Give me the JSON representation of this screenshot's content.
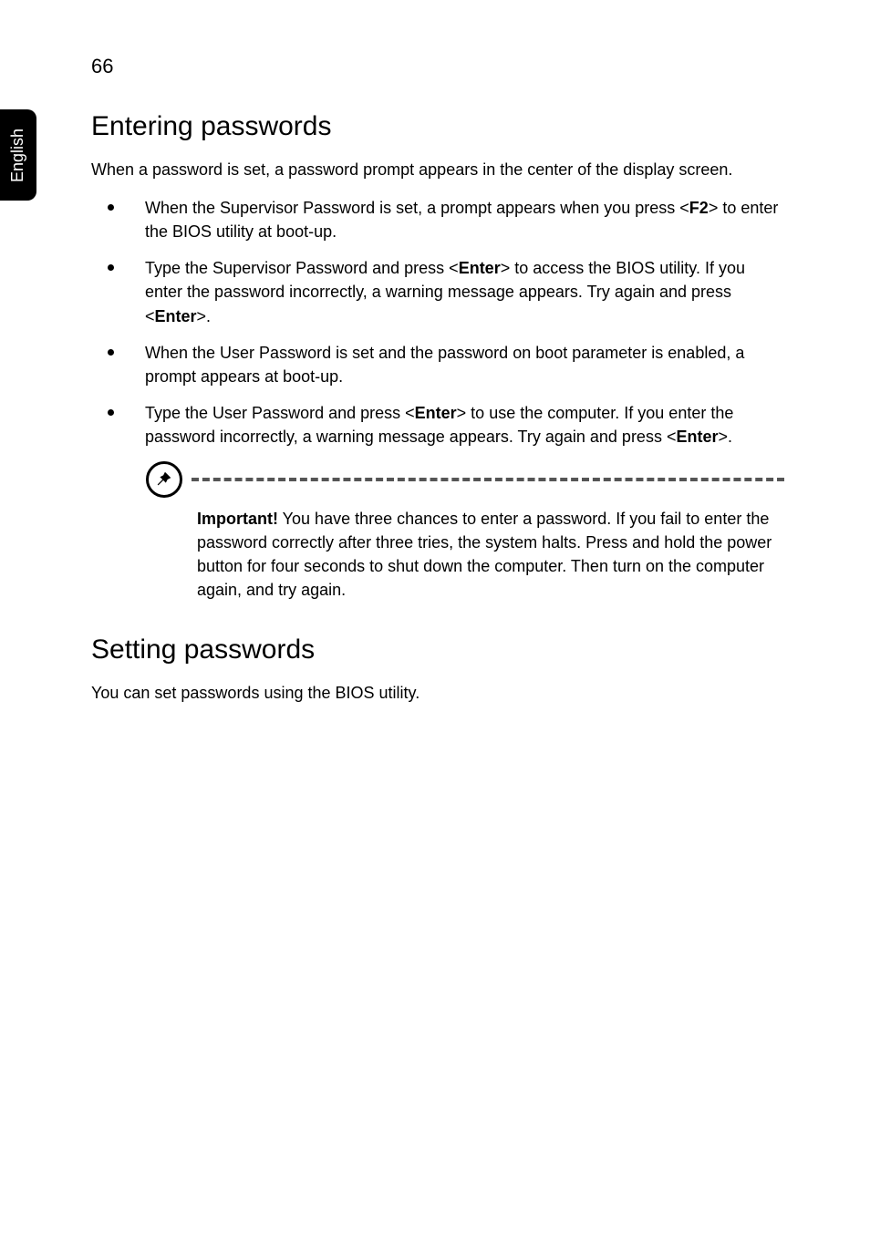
{
  "sidebar": {
    "language": "English"
  },
  "page": {
    "number": "66"
  },
  "section1": {
    "heading": "Entering passwords",
    "intro": "When a password is set, a password prompt appears in the center of the display screen.",
    "bullets": {
      "b1a": "When the Supervisor Password is set, a prompt appears when you press <",
      "b1b": "F2",
      "b1c": "> to enter the BIOS utility at boot-up.",
      "b2a": "Type the Supervisor Password and press <",
      "b2b": "Enter",
      "b2c": "> to access the BIOS utility. If you enter the password incorrectly, a warning message appears. Try again and press <",
      "b2d": "Enter",
      "b2e": ">.",
      "b3": "When the User Password is set and the password on boot parameter is enabled, a prompt appears at boot-up.",
      "b4a": "Type the User Password and press <",
      "b4b": "Enter",
      "b4c": "> to use the computer. If you enter the password incorrectly, a warning message appears. Try again and press <",
      "b4d": "Enter",
      "b4e": ">."
    }
  },
  "callout": {
    "label": "Important!",
    "text": " You have three chances to enter a password. If you fail to enter the password correctly after three tries, the system halts. Press and hold the power button for four seconds to shut down the computer. Then turn on the computer again, and try again."
  },
  "section2": {
    "heading": "Setting passwords",
    "body": "You can set passwords using the BIOS utility."
  }
}
